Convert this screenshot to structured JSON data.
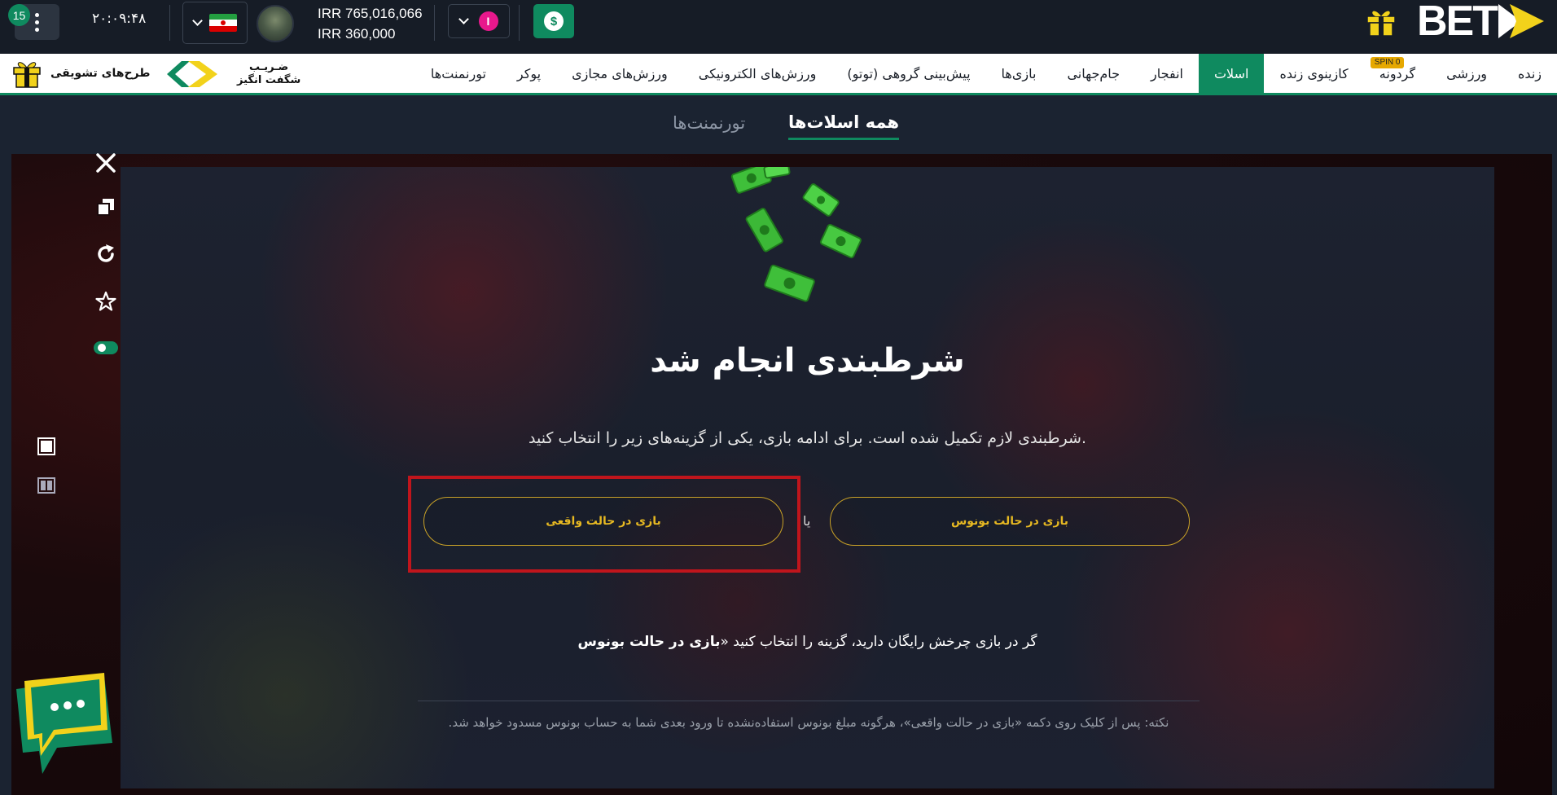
{
  "topbar": {
    "notif_count": "15",
    "clock": "۲۰:۰۹:۴۸",
    "balance_main": "IRR 765,016,066",
    "balance_bonus": "IRR 360,000",
    "account_initial": "I",
    "deposit_symbol": "$",
    "brand": "BET",
    "flag_colors": [
      "#239f40",
      "#ffffff",
      "#da0000"
    ],
    "icons": [
      "menu-dots-icon",
      "chevron-down-icon",
      "iran-flag-icon",
      "dollar-icon",
      "gift-icon",
      "brand-arrow-icon"
    ]
  },
  "nav": {
    "items": [
      {
        "label": "زنده"
      },
      {
        "label": "ورزشی"
      },
      {
        "label": "گردونه",
        "badge": "SPIN 0"
      },
      {
        "label": "کازینوی زنده"
      },
      {
        "label": "اسلات",
        "active": true
      },
      {
        "label": "انفجار"
      },
      {
        "label": "جام‌جهانی"
      },
      {
        "label": "بازی‌ها"
      },
      {
        "label": "پیش‌بینی گروهی (توتو)"
      },
      {
        "label": "ورزش‌های الکترونیکی"
      },
      {
        "label": "ورزش‌های مجازی"
      },
      {
        "label": "پوکر"
      },
      {
        "label": "تورنمنت‌ها"
      }
    ],
    "promo_mid_line1": "ضـریـب",
    "promo_mid_line2": "شگفت انگیز",
    "promo_left": "طرح‌های تشویقی"
  },
  "subtabs": {
    "all_slots": "همه اسلات‌ها",
    "tournaments": "تورنمنت‌ها"
  },
  "dialog": {
    "title": "شرطبندی انجام شد",
    "description": "شرطبندی لازم تکمیل شده است. برای ادامه بازی، یکی از گزینه‌های زیر را انتخاب کنید.",
    "bonus_button": "بازی در حالت بونوس",
    "or": "یا",
    "real_button": "بازی در حالت واقعی",
    "note1_text": "گر در بازی چرخش رایگان دارید، گزینه را انتخاب کنید «",
    "note1_bold": "بازی در حالت بونوس",
    "note2": "نکته: پس از کلیک روی دکمه «بازی در حالت واقعی»، هرگونه مبلغ بونوس استفاده‌نشده تا ورود بعدی شما به حساب بونوس مسدود خواهد شد."
  },
  "colors": {
    "accent_green": "#0f8a5f",
    "gold": "#e7b922",
    "highlight_red": "#c0151c",
    "brand_yellow": "#f2d21b"
  }
}
